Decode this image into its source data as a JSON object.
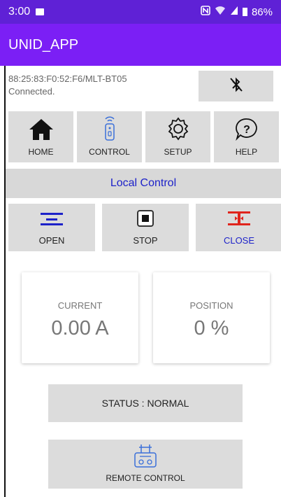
{
  "statusbar": {
    "time": "3:00",
    "battery": "86%"
  },
  "appbar": {
    "title": "UNID_APP"
  },
  "connection": {
    "device": "88:25:83:F0:52:F6/MLT-BT05",
    "state": "Connected."
  },
  "nav": {
    "home": "HOME",
    "control": "CONTROL",
    "setup": "SETUP",
    "help": "HELP"
  },
  "section": {
    "title": "Local Control"
  },
  "controls": {
    "open": "OPEN",
    "stop": "STOP",
    "close": "CLOSE"
  },
  "current": {
    "label": "CURRENT",
    "value": "0.00 A"
  },
  "position": {
    "label": "POSITION",
    "value": "0 %"
  },
  "status": {
    "text": "STATUS : NORMAL"
  },
  "remote": {
    "label": "REMOTE CONTROL"
  },
  "colors": {
    "statusbar": "#5f21d6",
    "appbar": "#7b1ff5",
    "accent_blue": "#1d22c9",
    "close_red": "#e0241c"
  },
  "icons": [
    "image-icon",
    "nfc-icon",
    "wifi-icon",
    "signal-icon",
    "battery-icon",
    "bluetooth-off-icon",
    "home-icon",
    "remote-icon",
    "gear-icon",
    "help-icon",
    "open-icon",
    "stop-icon",
    "close-icon",
    "remote-control-icon"
  ]
}
